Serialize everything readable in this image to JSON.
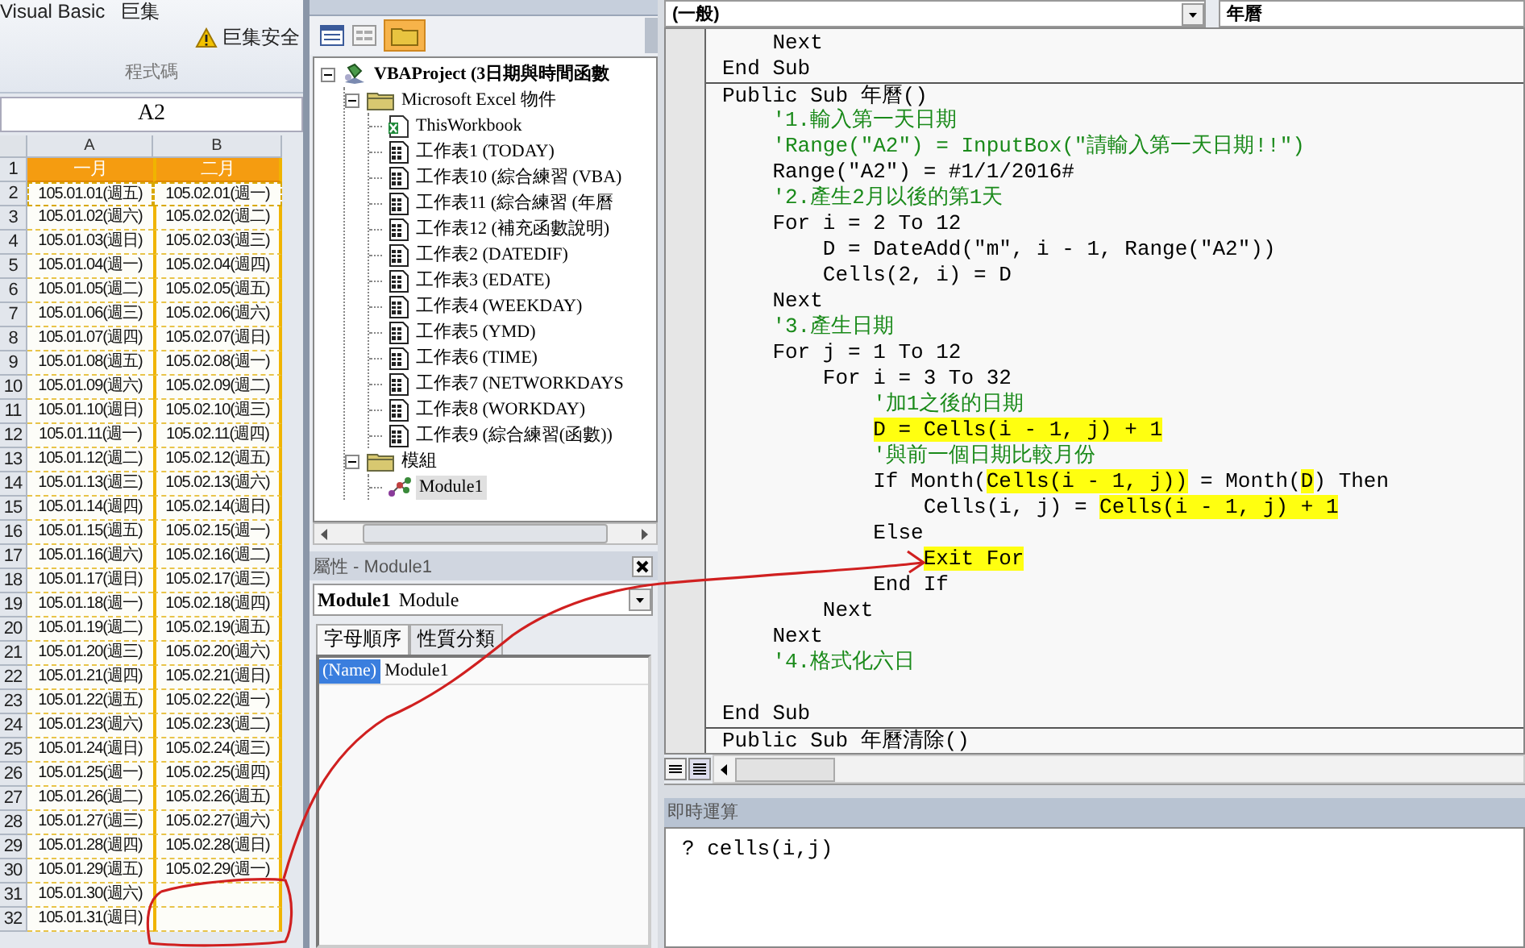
{
  "ribbon": {
    "buttons": [
      {
        "label": "Visual Basic"
      },
      {
        "label": "巨集"
      }
    ],
    "security_label": "巨集安全",
    "group_label": "程式碼"
  },
  "name_box": "A2",
  "sheet": {
    "columns": [
      "A",
      "B"
    ],
    "header_row": {
      "number": "1",
      "cells": [
        "一月",
        "二月"
      ]
    },
    "rows": [
      {
        "number": "2",
        "cells": [
          "105.01.01(週五)",
          "105.02.01(週一)"
        ]
      },
      {
        "number": "3",
        "cells": [
          "105.01.02(週六)",
          "105.02.02(週二)"
        ]
      },
      {
        "number": "4",
        "cells": [
          "105.01.03(週日)",
          "105.02.03(週三)"
        ]
      },
      {
        "number": "5",
        "cells": [
          "105.01.04(週一)",
          "105.02.04(週四)"
        ]
      },
      {
        "number": "6",
        "cells": [
          "105.01.05(週二)",
          "105.02.05(週五)"
        ]
      },
      {
        "number": "7",
        "cells": [
          "105.01.06(週三)",
          "105.02.06(週六)"
        ]
      },
      {
        "number": "8",
        "cells": [
          "105.01.07(週四)",
          "105.02.07(週日)"
        ]
      },
      {
        "number": "9",
        "cells": [
          "105.01.08(週五)",
          "105.02.08(週一)"
        ]
      },
      {
        "number": "10",
        "cells": [
          "105.01.09(週六)",
          "105.02.09(週二)"
        ]
      },
      {
        "number": "11",
        "cells": [
          "105.01.10(週日)",
          "105.02.10(週三)"
        ]
      },
      {
        "number": "12",
        "cells": [
          "105.01.11(週一)",
          "105.02.11(週四)"
        ]
      },
      {
        "number": "13",
        "cells": [
          "105.01.12(週二)",
          "105.02.12(週五)"
        ]
      },
      {
        "number": "14",
        "cells": [
          "105.01.13(週三)",
          "105.02.13(週六)"
        ]
      },
      {
        "number": "15",
        "cells": [
          "105.01.14(週四)",
          "105.02.14(週日)"
        ]
      },
      {
        "number": "16",
        "cells": [
          "105.01.15(週五)",
          "105.02.15(週一)"
        ]
      },
      {
        "number": "17",
        "cells": [
          "105.01.16(週六)",
          "105.02.16(週二)"
        ]
      },
      {
        "number": "18",
        "cells": [
          "105.01.17(週日)",
          "105.02.17(週三)"
        ]
      },
      {
        "number": "19",
        "cells": [
          "105.01.18(週一)",
          "105.02.18(週四)"
        ]
      },
      {
        "number": "20",
        "cells": [
          "105.01.19(週二)",
          "105.02.19(週五)"
        ]
      },
      {
        "number": "21",
        "cells": [
          "105.01.20(週三)",
          "105.02.20(週六)"
        ]
      },
      {
        "number": "22",
        "cells": [
          "105.01.21(週四)",
          "105.02.21(週日)"
        ]
      },
      {
        "number": "23",
        "cells": [
          "105.01.22(週五)",
          "105.02.22(週一)"
        ]
      },
      {
        "number": "24",
        "cells": [
          "105.01.23(週六)",
          "105.02.23(週二)"
        ]
      },
      {
        "number": "25",
        "cells": [
          "105.01.24(週日)",
          "105.02.24(週三)"
        ]
      },
      {
        "number": "26",
        "cells": [
          "105.01.25(週一)",
          "105.02.25(週四)"
        ]
      },
      {
        "number": "27",
        "cells": [
          "105.01.26(週二)",
          "105.02.26(週五)"
        ]
      },
      {
        "number": "28",
        "cells": [
          "105.01.27(週三)",
          "105.02.27(週六)"
        ]
      },
      {
        "number": "29",
        "cells": [
          "105.01.28(週四)",
          "105.02.28(週日)"
        ]
      },
      {
        "number": "30",
        "cells": [
          "105.01.29(週五)",
          "105.02.29(週一)"
        ]
      },
      {
        "number": "31",
        "cells": [
          "105.01.30(週六)"
        ]
      },
      {
        "number": "32",
        "cells": [
          "105.01.31(週日)"
        ]
      }
    ]
  },
  "project": {
    "tree": [
      {
        "label": "VBAProject (3日期與時間函數",
        "kind": "project",
        "expanded": true,
        "selected": false,
        "children": [
          {
            "label": "Microsoft Excel 物件",
            "kind": "folder",
            "expanded": true,
            "selected": false,
            "children": [
              {
                "label": "ThisWorkbook",
                "kind": "workbook",
                "selected": false
              },
              {
                "label": "工作表1 (TODAY)",
                "kind": "sheet",
                "selected": false
              },
              {
                "label": "工作表10 (綜合練習 (VBA)",
                "kind": "sheet",
                "selected": false
              },
              {
                "label": "工作表11 (綜合練習 (年曆",
                "kind": "sheet",
                "selected": false
              },
              {
                "label": "工作表12 (補充函數說明)",
                "kind": "sheet",
                "selected": false
              },
              {
                "label": "工作表2 (DATEDIF)",
                "kind": "sheet",
                "selected": false
              },
              {
                "label": "工作表3 (EDATE)",
                "kind": "sheet",
                "selected": false
              },
              {
                "label": "工作表4 (WEEKDAY)",
                "kind": "sheet",
                "selected": false
              },
              {
                "label": "工作表5 (YMD)",
                "kind": "sheet",
                "selected": false
              },
              {
                "label": "工作表6 (TIME)",
                "kind": "sheet",
                "selected": false
              },
              {
                "label": "工作表7 (NETWORKDAYS",
                "kind": "sheet",
                "selected": false
              },
              {
                "label": "工作表8 (WORKDAY)",
                "kind": "sheet",
                "selected": false
              },
              {
                "label": "工作表9 (綜合練習(函數))",
                "kind": "sheet",
                "selected": false
              }
            ]
          },
          {
            "label": "模組",
            "kind": "folder",
            "expanded": true,
            "selected": false,
            "children": [
              {
                "label": "Module1",
                "kind": "module",
                "selected": true
              }
            ]
          }
        ]
      }
    ]
  },
  "properties": {
    "title": "屬性 - Module1",
    "object_name": "Module1",
    "object_type": "Module",
    "tabs": [
      {
        "label": "字母順序",
        "selected": true
      },
      {
        "label": "性質分類",
        "selected": false
      }
    ],
    "rows": [
      {
        "name": "(Name)",
        "value": "Module1",
        "selected": true
      }
    ]
  },
  "code": {
    "object_dropdown": "(一般)",
    "procedure_dropdown": "年曆",
    "lines": [
      {
        "kind": "code",
        "text": "    Next"
      },
      {
        "kind": "code",
        "text": "End Sub"
      },
      {
        "kind": "code",
        "separator": true,
        "text": "Public Sub 年曆()"
      },
      {
        "kind": "comment",
        "text": "    '1.輸入第一天日期"
      },
      {
        "kind": "comment",
        "text": "    'Range(\"A2\") = InputBox(\"請輸入第一天日期!!\")"
      },
      {
        "kind": "code",
        "text": "    Range(\"A2\") = #1/1/2016#"
      },
      {
        "kind": "comment",
        "text": "    '2.產生2月以後的第1天"
      },
      {
        "kind": "code",
        "text": "    For i = 2 To 12"
      },
      {
        "kind": "code",
        "text": "        D = DateAdd(\"m\", i - 1, Range(\"A2\"))"
      },
      {
        "kind": "code",
        "text": "        Cells(2, i) = D"
      },
      {
        "kind": "code",
        "text": "    Next"
      },
      {
        "kind": "comment",
        "text": "    '3.產生日期"
      },
      {
        "kind": "code",
        "text": "    For j = 1 To 12"
      },
      {
        "kind": "code",
        "text": "        For i = 3 To 32"
      },
      {
        "kind": "comment",
        "text": "            '加1之後的日期"
      },
      {
        "kind": "code",
        "segments": [
          {
            "text": "            D = Cells(i - 1, j) + 1",
            "highlight": true
          }
        ]
      },
      {
        "kind": "comment",
        "text": "            '與前一個日期比較月份"
      },
      {
        "kind": "code",
        "segments": [
          {
            "text": "            If Month(",
            "highlight": false
          },
          {
            "text": "Cells(i - 1, j))",
            "highlight": true
          },
          {
            "text": " = Month(",
            "highlight": false
          },
          {
            "text": "D",
            "highlight": true
          },
          {
            "text": ") Then",
            "highlight": false
          }
        ]
      },
      {
        "kind": "code",
        "segments": [
          {
            "text": "                Cells(i, j) = ",
            "highlight": false
          },
          {
            "text": "Cells(i - 1, j) + 1",
            "highlight": true
          }
        ]
      },
      {
        "kind": "code",
        "text": "            Else"
      },
      {
        "kind": "code",
        "segments": [
          {
            "text": "                Exit For",
            "highlight": true
          }
        ]
      },
      {
        "kind": "code",
        "text": "            End If"
      },
      {
        "kind": "code",
        "text": "        Next"
      },
      {
        "kind": "code",
        "text": "    Next"
      },
      {
        "kind": "comment",
        "text": "    '4.格式化六日"
      },
      {
        "kind": "blank"
      },
      {
        "kind": "code",
        "text": "End Sub"
      },
      {
        "kind": "code",
        "separator": true,
        "text": "Public Sub 年曆清除()"
      }
    ]
  },
  "immediate": {
    "title": "即時運算",
    "lines": [
      "? cells(i,j)"
    ]
  }
}
